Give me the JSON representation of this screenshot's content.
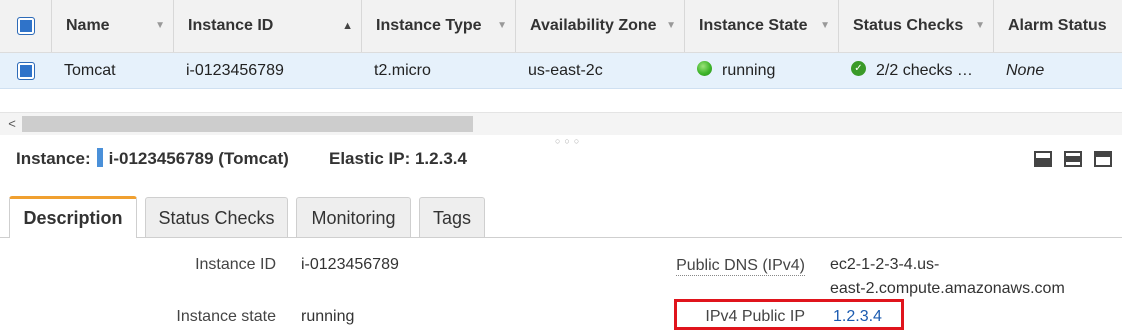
{
  "grid": {
    "columns": [
      "Name",
      "Instance ID",
      "Instance Type",
      "Availability Zone",
      "Instance State",
      "Status Checks",
      "Alarm Status"
    ],
    "row": {
      "name": "Tomcat",
      "instance_id": "i-0123456789",
      "instance_type": "t2.micro",
      "availability_zone": "us-east-2c",
      "instance_state": "running",
      "status_checks": "2/2 checks …",
      "alarm_status": "None"
    }
  },
  "detail": {
    "instance_label": "Instance:",
    "instance_value": "i-0123456789 (Tomcat)",
    "elastic_ip": "Elastic IP: 1.2.3.4"
  },
  "tabs": [
    "Description",
    "Status Checks",
    "Monitoring",
    "Tags"
  ],
  "description": {
    "instance_id_label": "Instance ID",
    "instance_id_value": "i-0123456789",
    "instance_state_label": "Instance state",
    "instance_state_value": "running",
    "public_dns_label": "Public DNS (IPv4)",
    "public_dns_line1": "ec2-1-2-3-4.us-",
    "public_dns_line2": "east-2.compute.amazonaws.com",
    "ipv4_label": "IPv4 Public IP",
    "ipv4_value": "1.2.3.4"
  },
  "colors": {
    "accent_tab": "#f0a030",
    "selection_row": "#e6f1fb",
    "highlight": "#e0141c",
    "link": "#1b5bb0",
    "running": "#3fb52b"
  }
}
